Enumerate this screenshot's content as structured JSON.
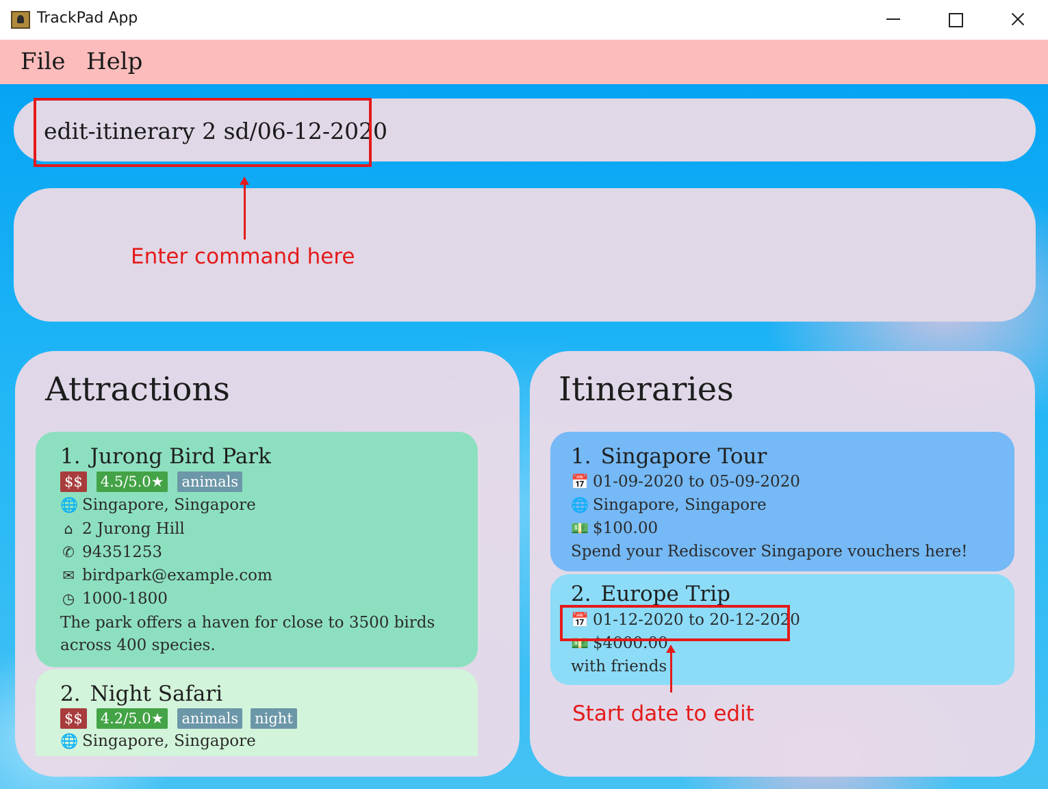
{
  "window": {
    "title": "TrackPad App"
  },
  "menu": {
    "file": "File",
    "help": "Help"
  },
  "command": {
    "value": "edit-itinerary 2 sd/06-12-2020"
  },
  "annotations": {
    "command": "Enter command here",
    "start_date": "Start date to edit"
  },
  "attractions": {
    "title": "Attractions",
    "items": [
      {
        "index": "1.",
        "name": "Jurong Bird Park",
        "price": "$$",
        "rating": "4.5/5.0★",
        "tags": [
          "animals"
        ],
        "location": "Singapore, Singapore",
        "address": "2 Jurong Hill",
        "phone": "94351253",
        "email": "birdpark@example.com",
        "hours": "1000-1800",
        "description": "The park offers a haven for close to 3500 birds across 400 species."
      },
      {
        "index": "2.",
        "name": "Night Safari",
        "price": "$$",
        "rating": "4.2/5.0★",
        "tags": [
          "animals",
          "night"
        ],
        "location": "Singapore, Singapore"
      }
    ]
  },
  "itineraries": {
    "title": "Itineraries",
    "items": [
      {
        "index": "1.",
        "name": "Singapore Tour",
        "dates": "01-09-2020 to 05-09-2020",
        "location": "Singapore, Singapore",
        "budget": "$100.00",
        "description": "Spend your Rediscover Singapore vouchers here!"
      },
      {
        "index": "2.",
        "name": "Europe Trip",
        "dates": "01-12-2020 to 20-12-2020",
        "budget": "$4000.00",
        "description": "with friends"
      }
    ]
  },
  "colors": {
    "menubar": "#fdbcbc",
    "attraction_card_1": "#8de0bf",
    "attraction_card_2": "#d2f4da",
    "itinerary_card_1": "#75b9f6",
    "itinerary_card_2": "#8cdcf8",
    "annotation": "#e41a1a"
  }
}
